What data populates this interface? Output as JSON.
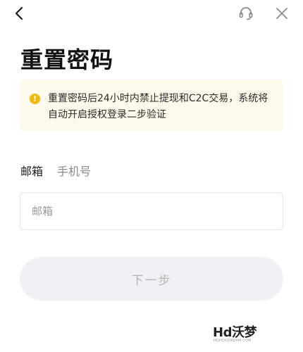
{
  "header": {
    "back_icon": "chevron-left-icon",
    "support_icon": "headset-icon",
    "close_icon": "close-icon"
  },
  "page": {
    "title": "重置密码"
  },
  "notice": {
    "icon": "exclamation-circle-icon",
    "icon_color": "#f0b90b",
    "background": "#fdf9eb",
    "text": "重置密码后24小时内禁止提现和C2C交易，系统将自动开启授权登录二步验证"
  },
  "tabs": [
    {
      "label": "邮箱",
      "active": true
    },
    {
      "label": "手机号",
      "active": false
    }
  ],
  "email_input": {
    "placeholder": "邮箱",
    "value": ""
  },
  "next_button": {
    "label": "下一步",
    "disabled": true
  },
  "watermark": {
    "main": "Hd沃梦",
    "sub": "HDHOODREAM.COM"
  }
}
